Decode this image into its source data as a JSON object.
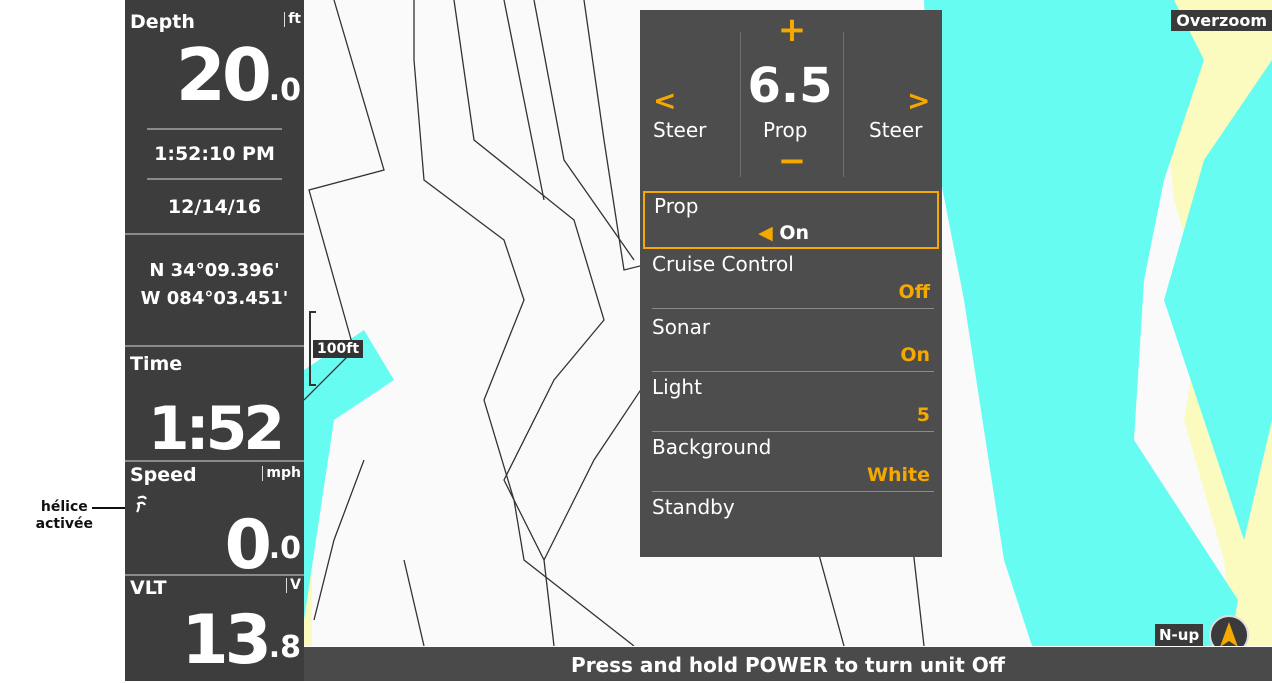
{
  "callout": {
    "line1": "hélice",
    "line2": "activée"
  },
  "sidebar": {
    "depth": {
      "label": "Depth",
      "unit": "ft",
      "int": "20",
      "dec": ".0"
    },
    "clock": "1:52:10 PM",
    "date": "12/14/16",
    "lat": "N 34°09.396'",
    "lon": "W 084°03.451'",
    "time": {
      "label": "Time",
      "value": "1:52"
    },
    "speed": {
      "label": "Speed",
      "unit": "mph",
      "int": "0",
      "dec": ".0"
    },
    "vlt": {
      "label": "VLT",
      "unit": "V",
      "int": "13",
      "dec": ".8"
    }
  },
  "map": {
    "overzoom": "Overzoom",
    "scale": "100ft",
    "orientation": "N-up",
    "colors": {
      "water": "#66fcf2",
      "land": "#fbfbc0",
      "contour_bg": "#fafafa"
    }
  },
  "menu": {
    "steer_left": "Steer",
    "steer_right": "Steer",
    "prop_label": "Prop",
    "prop_value": "6.5",
    "plus": "+",
    "minus": "−",
    "left_arrow": "<",
    "right_arrow": ">",
    "items": [
      {
        "label": "Prop",
        "value": "On",
        "selected": true
      },
      {
        "label": "Cruise Control",
        "value": "Off"
      },
      {
        "label": "Sonar",
        "value": "On"
      },
      {
        "label": "Light",
        "value": "5"
      },
      {
        "label": "Background",
        "value": "White"
      },
      {
        "label": "Standby",
        "value": ""
      }
    ]
  },
  "status": "Press and hold POWER to turn unit Off",
  "accent_color": "#f5a800"
}
